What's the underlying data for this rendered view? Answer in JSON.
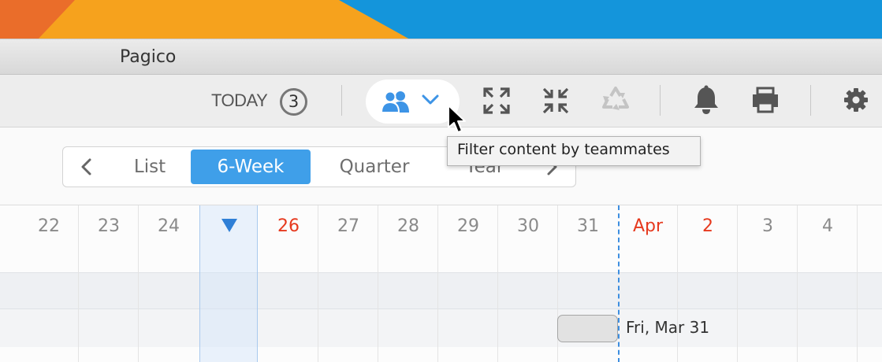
{
  "window": {
    "title": "Pagico"
  },
  "toolbar": {
    "today_label": "TODAY",
    "today_count": "3",
    "buttons": [
      "team-filter",
      "expand",
      "collapse",
      "recycle",
      "notifications",
      "print",
      "settings"
    ]
  },
  "tooltip": {
    "text": "Filter content by teammates"
  },
  "view_switcher": {
    "options": [
      "List",
      "6-Week",
      "Quarter",
      "Year"
    ],
    "selected": "6-Week"
  },
  "calendar": {
    "days": [
      "22",
      "23",
      "24",
      "",
      "26",
      "27",
      "28",
      "29",
      "30",
      "31",
      "Apr",
      "2",
      "3",
      "4"
    ],
    "today_index": 3,
    "highlight_days": [
      "26",
      "Apr",
      "2"
    ],
    "event": {
      "label": "Fri, Mar 31"
    }
  },
  "colors": {
    "accent": "#3f9fe9",
    "weekend_red": "#e6391e",
    "team_icon": "#3d94e6",
    "today_marker": "#2f7fd6",
    "icon_dark": "#555555",
    "icon_disabled": "#c4c4c4"
  }
}
